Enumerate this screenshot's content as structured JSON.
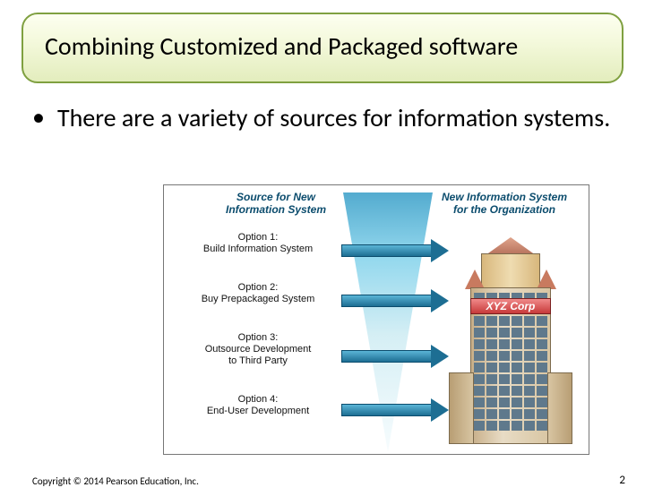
{
  "title": "Combining Customized and Packaged software",
  "bullet": "There are a variety of sources for information systems.",
  "figure": {
    "header_left_l1": "Source for New",
    "header_left_l2": "Information System",
    "header_right_l1": "New Information System",
    "header_right_l2": "for the Organization",
    "options": [
      {
        "line1": "Option 1:",
        "line2": "Build Information System"
      },
      {
        "line1": "Option 2:",
        "line2": "Buy Prepackaged System"
      },
      {
        "line1": "Option 3:",
        "line2": "Outsource Development",
        "line3": "to Third Party"
      },
      {
        "line1": "Option 4:",
        "line2": "End-User Development"
      }
    ],
    "building_sign": "XYZ Corp"
  },
  "footer": "Copyright © 2014 Pearson Education, Inc.",
  "page_number": "2"
}
